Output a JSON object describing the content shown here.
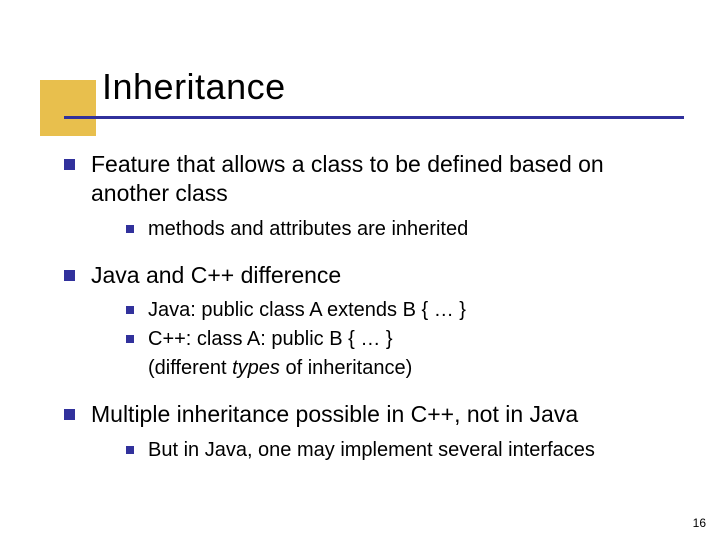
{
  "title": "Inheritance",
  "bullets": {
    "b1": "Feature that allows a class to be defined based on another class",
    "b1_1": "methods and attributes are inherited",
    "b2": "Java and C++ difference",
    "b2_1": "Java:  public class A extends B { … }",
    "b2_2": "C++:  class A: public B { … }",
    "b2_2_cont_pre": "(different ",
    "b2_2_cont_em": "types",
    "b2_2_cont_post": " of inheritance)",
    "b3": "Multiple inheritance possible in C++, not in Java",
    "b3_1": "But in Java, one may implement several interfaces"
  },
  "page_number": "16"
}
